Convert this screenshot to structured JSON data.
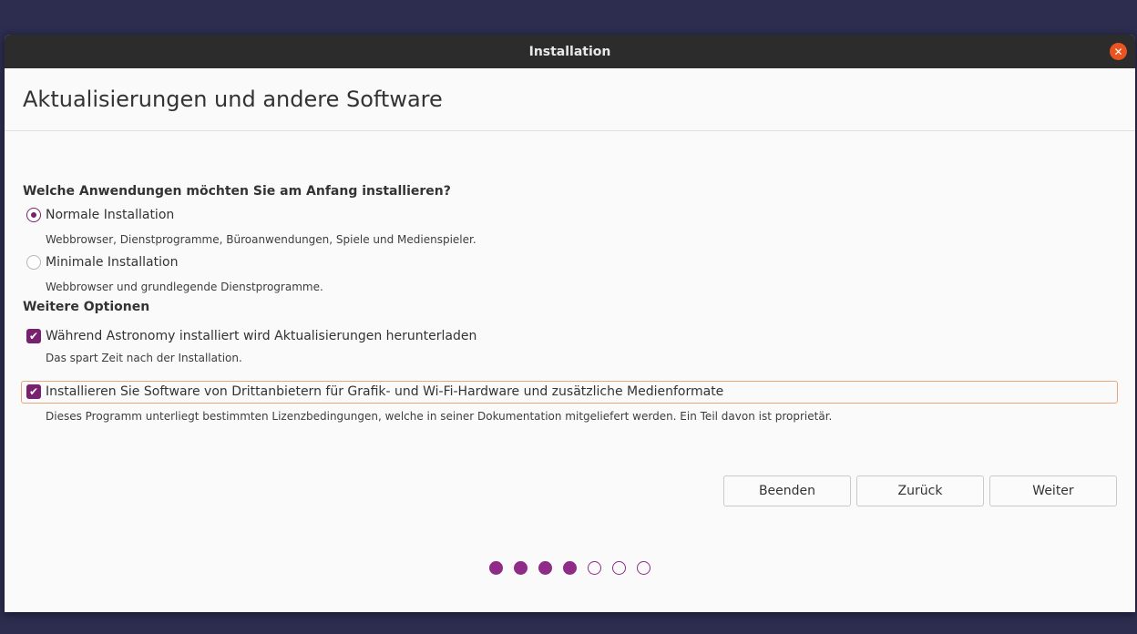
{
  "window": {
    "title": "Installation"
  },
  "page": {
    "title": "Aktualisierungen und andere Software"
  },
  "install_section": {
    "heading": "Welche Anwendungen möchten Sie am Anfang installieren?",
    "options": [
      {
        "label": "Normale Installation",
        "description": "Webbrowser, Dienstprogramme, Büroanwendungen, Spiele und Medienspieler.",
        "selected": true
      },
      {
        "label": "Minimale Installation",
        "description": "Webbrowser und grundlegende Dienstprogramme.",
        "selected": false
      }
    ]
  },
  "other_section": {
    "heading": "Weitere Optionen",
    "options": [
      {
        "label": "Während Astronomy installiert wird Aktualisierungen herunterladen",
        "description": "Das spart Zeit nach der Installation.",
        "checked": true
      },
      {
        "label": "Installieren Sie Software von Drittanbietern für Grafik- und Wi-Fi-Hardware und zusätzliche Medienformate",
        "description": "Dieses Programm unterliegt bestimmten Lizenzbedingungen, welche in seiner Dokumentation mitgeliefert werden. Ein Teil davon ist proprietär.",
        "checked": true
      }
    ]
  },
  "buttons": {
    "quit": "Beenden",
    "back": "Zurück",
    "next": "Weiter"
  },
  "progress": {
    "total_steps": 7,
    "completed_steps": 4
  },
  "icons": {
    "close": "close-icon",
    "checkmark": "checkmark-icon"
  },
  "colors": {
    "accent": "#77216f",
    "close": "#e95420",
    "focus": "#e9a67e",
    "titlebar": "#2c2c2c"
  }
}
